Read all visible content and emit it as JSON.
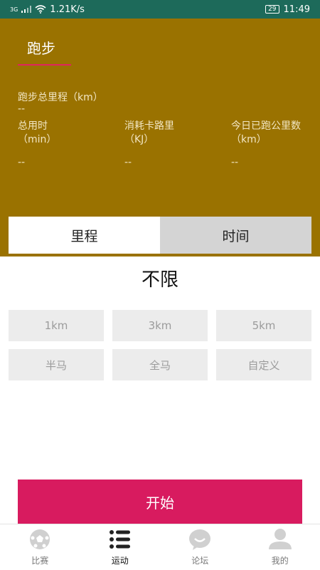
{
  "status_bar": {
    "net_speed": "1.21K/s",
    "signal_label": "3G",
    "battery": "29",
    "time": "11:49"
  },
  "header": {
    "tab": "跑步",
    "total_distance": {
      "label": "跑步总里程（km）",
      "value": "--"
    },
    "stats": [
      {
        "label": "总用时",
        "unit": "（min）",
        "value": "--"
      },
      {
        "label": "消耗卡路里",
        "unit": "（KJ）",
        "value": "--"
      },
      {
        "label": "今日已跑公里数",
        "unit": "（km）",
        "value": "--"
      }
    ]
  },
  "mode_tabs": [
    {
      "label": "里程",
      "active": true
    },
    {
      "label": "时间",
      "active": false
    }
  ],
  "selected_target": "不限",
  "options": [
    "1km",
    "3km",
    "5km",
    "半马",
    "全马",
    "自定义"
  ],
  "start_button": "开始",
  "bottom_nav": [
    {
      "label": "比赛",
      "icon": "soccer-ball-icon",
      "active": false
    },
    {
      "label": "运动",
      "icon": "list-icon",
      "active": true
    },
    {
      "label": "论坛",
      "icon": "chat-bubble-icon",
      "active": false
    },
    {
      "label": "我的",
      "icon": "user-icon",
      "active": false
    }
  ],
  "colors": {
    "status_bar": "#1d6a5a",
    "header": "#9a7200",
    "accent": "#d81b5f",
    "option_bg": "#ececec"
  }
}
